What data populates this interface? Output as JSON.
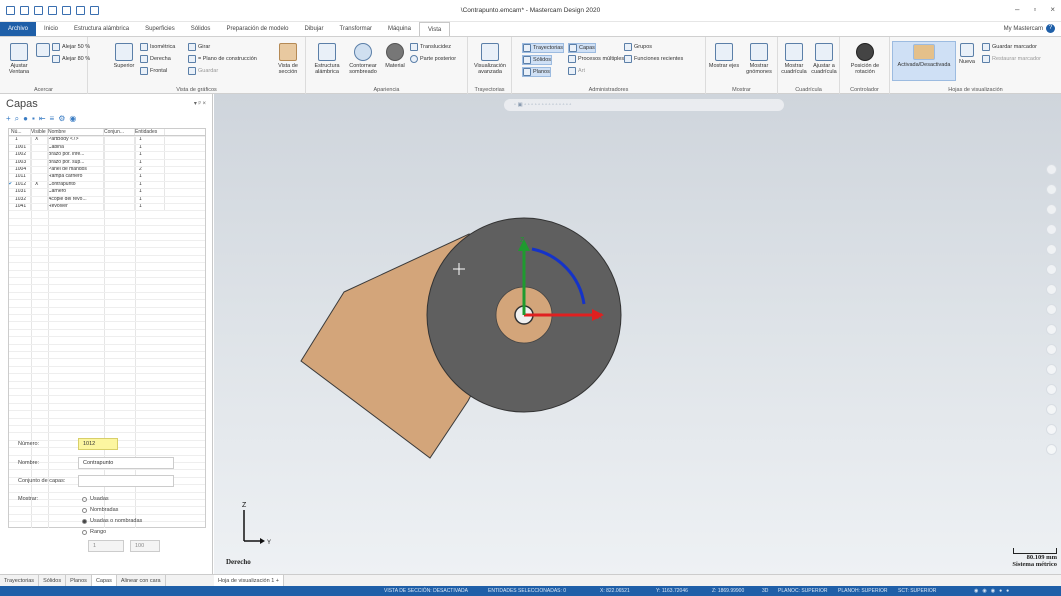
{
  "window": {
    "title": "\\Contrapunto.emcam* - Mastercam Design 2020"
  },
  "tabs": [
    "Archivo",
    "Inicio",
    "Estructura alámbrica",
    "Superficies",
    "Sólidos",
    "Preparación de modelo",
    "Dibujar",
    "Transformar",
    "Máquina",
    "Vista"
  ],
  "account": {
    "label": "My Mastercam"
  },
  "ribbon": {
    "acercar": {
      "label": "Acercar",
      "fit": "Ajustar Ventana",
      "zoom_out_50": "Alejar 50 %",
      "zoom_out_80": "Alejar 80 %"
    },
    "vistas": {
      "label": "Vista de gráficos",
      "superior": "Superior",
      "isometrica": "Isométrica",
      "girar": "Girar",
      "derecha": "Derecha",
      "frontal": "Frontal",
      "plano": "= Plano de construcción",
      "guardar": "Guardar",
      "vista_seccion": "Vista de sección"
    },
    "apariencia": {
      "label": "Apariencia",
      "estructura": "Estructura alámbrica",
      "contornear": "Contornear sombreado",
      "material": "Material",
      "translucidez": "Translucidez",
      "parte_posterior": "Parte posterior"
    },
    "trayectorias": {
      "label": "Trayectorias",
      "visualizacion": "Visualización avanzada"
    },
    "administradores": {
      "label": "Administradores",
      "trayectorias": "Trayectorias",
      "capas": "Capas",
      "grupos": "Grupos",
      "solidos": "Sólidos",
      "procesos": "Procesos múltiples",
      "funciones": "Funciones recientes",
      "planos": "Planos",
      "art": "Art"
    },
    "mostrar": {
      "label": "Mostrar",
      "ejes": "Mostrar ejes",
      "gnomones": "Mostrar gnómones"
    },
    "cuadricula": {
      "label": "Cuadrícula",
      "mostrar": "Mostrar cuadrícula",
      "ajustar": "Ajustar a cuadrícula"
    },
    "controlador": {
      "label": "Controlador",
      "posicion": "Posición de rotación"
    },
    "hojas": {
      "label": "Hojas de visualización",
      "activada": "Activada/Desactivada",
      "nueva": "Nueva",
      "guardar": "Guardar marcador",
      "restaurar": "Restaurar marcador"
    }
  },
  "panel": {
    "title": "Capas",
    "columns": [
      "Nú...",
      "Visible",
      "Nombre",
      "Conjun...",
      "Entidades"
    ],
    "rows": [
      {
        "num": "1",
        "visible": "X",
        "name": "PartBody <7>",
        "set": "",
        "count": "1",
        "current": false
      },
      {
        "num": "1001",
        "visible": "",
        "name": "Cabina",
        "set": "",
        "count": "1",
        "current": false
      },
      {
        "num": "1002",
        "visible": "",
        "name": "Brazo por. infe...",
        "set": "",
        "count": "1",
        "current": false
      },
      {
        "num": "1003",
        "visible": "",
        "name": "Brazo por. sup...",
        "set": "",
        "count": "1",
        "current": false
      },
      {
        "num": "1004",
        "visible": "",
        "name": "Panel de mandos",
        "set": "",
        "count": "2",
        "current": false
      },
      {
        "num": "1011",
        "visible": "",
        "name": "Rampa carnero",
        "set": "",
        "count": "1",
        "current": false
      },
      {
        "num": "1012",
        "visible": "X",
        "name": "Contrapunto",
        "set": "",
        "count": "1",
        "current": true
      },
      {
        "num": "1031",
        "visible": "",
        "name": "Carnero",
        "set": "",
        "count": "1",
        "current": false
      },
      {
        "num": "1032",
        "visible": "",
        "name": "Acople del revo...",
        "set": "",
        "count": "1",
        "current": false
      },
      {
        "num": "1041",
        "visible": "",
        "name": "Revolver",
        "set": "",
        "count": "1",
        "current": false
      }
    ],
    "form": {
      "numero_label": "Número:",
      "numero_value": "1012",
      "nombre_label": "Nombre:",
      "nombre_value": "Contrapunto",
      "conjunto_label": "Conjunto de capas:",
      "conjunto_value": "",
      "mostrar_label": "Mostrar:",
      "options": [
        "Usadas",
        "Nombradas",
        "Usadas o nombradas",
        "Rango"
      ],
      "selected": "Usadas o nombradas",
      "range_from": "1",
      "range_to": "100"
    }
  },
  "bottom_tabs": [
    "Trayectorias",
    "Sólidos",
    "Planos",
    "Capas",
    "Alinear con cara"
  ],
  "sheet_tab": "Hoja de visualización 1",
  "viewport": {
    "view_name": "Derecho",
    "scale_value": "80.109 mm",
    "scale_unit": "Sistema métrico",
    "axis_x": "X",
    "axis_y": "Y",
    "axis_z": "Z"
  },
  "status": {
    "section": "VISTA DE SECCIÓN: DESACTIVADA",
    "entities": "ENTIDADES SELECCIONADAS: 0",
    "x": "X: 822.06521",
    "y": "Y: 1163.72046",
    "z": "Z: 1869.99900",
    "mode": "3D",
    "cplane": "PLANOC: SUPERIOR",
    "tplane": "PLANOH: SUPERIOR",
    "wcs": "SCT: SUPERIOR"
  },
  "colors": {
    "accent": "#1f5fa8",
    "part": "#d3a57a",
    "wheel": "#5f5f5f",
    "axis_x": "#e02020",
    "axis_y": "#1f9b2f",
    "arc": "#1533c8"
  }
}
